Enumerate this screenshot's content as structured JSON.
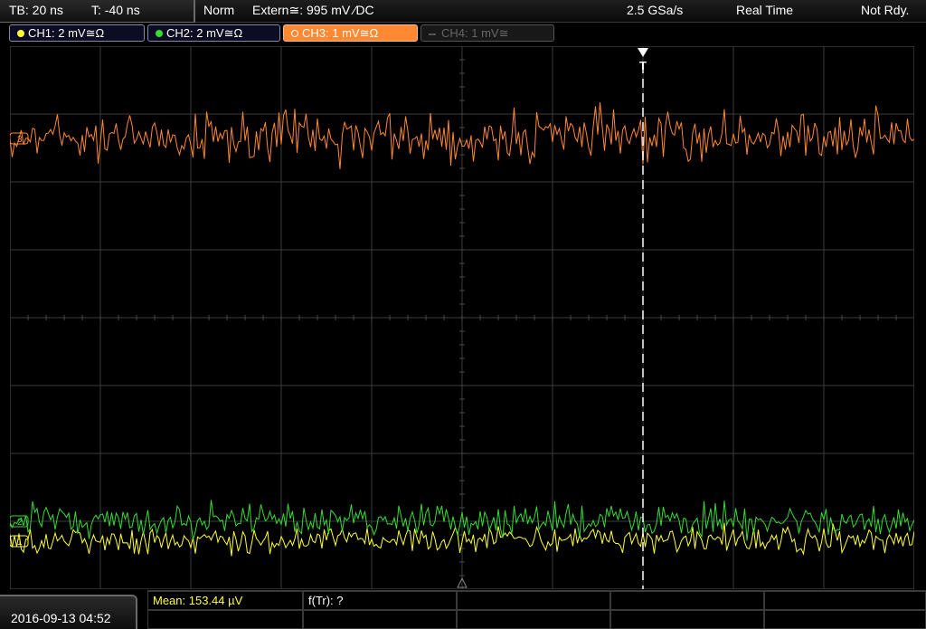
{
  "timebase": {
    "tb": "TB: 20 ns",
    "t": "T: -40 ns"
  },
  "status": {
    "mode": "Norm",
    "trigger": "Extern≅: 995 mV ⁄DC",
    "sample_rate": "2.5 GSa/s",
    "acq_mode": "Real Time",
    "state": "Not Rdy."
  },
  "channels": [
    {
      "id": "ch1",
      "label": "CH1: 2 mV≅Ω",
      "color": "#ffff33",
      "active": true
    },
    {
      "id": "ch2",
      "label": "CH2: 2 mV≅Ω",
      "color": "#33dd33",
      "active": true
    },
    {
      "id": "ch3",
      "label": "CH3: 1 mV≅Ω",
      "color": "#ff8833",
      "active": true,
      "selected": true
    },
    {
      "id": "ch4",
      "label": "CH4: 1 mV≅",
      "color": "#555555",
      "active": false
    }
  ],
  "trigger_marker": "T",
  "ch_markers": {
    "ch1": "1",
    "ch2": "2",
    "ch3": "3"
  },
  "datetime": "2016-09-13 04:52",
  "measurements": {
    "mean": "Mean: 153.44 µV",
    "ftr": "f(Tr): ?"
  },
  "colors": {
    "ch1": "#ffff33",
    "ch2": "#33dd33",
    "ch3": "#ff8833",
    "grid": "#3c3c3c",
    "trigger_line": "#ffffff"
  }
}
